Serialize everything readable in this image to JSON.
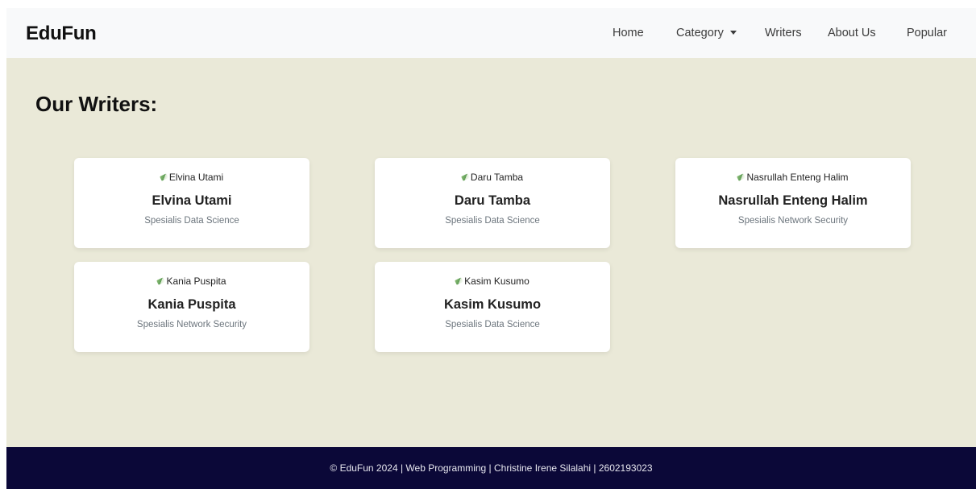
{
  "navbar": {
    "brand": "EduFun",
    "links": {
      "home": "Home",
      "category": "Category",
      "writers": "Writers",
      "about": "About Us",
      "popular": "Popular"
    }
  },
  "main": {
    "title": "Our Writers:",
    "writers": [
      {
        "img_alt": "Elvina Utami",
        "name": "Elvina Utami",
        "specialty": "Spesialis Data Science"
      },
      {
        "img_alt": "Daru Tamba",
        "name": "Daru Tamba",
        "specialty": "Spesialis Data Science"
      },
      {
        "img_alt": "Nasrullah Enteng Halim",
        "name": "Nasrullah Enteng Halim",
        "specialty": "Spesialis Network Security"
      },
      {
        "img_alt": "Kania Puspita",
        "name": "Kania Puspita",
        "specialty": "Spesialis Network Security"
      },
      {
        "img_alt": "Kasim Kusumo",
        "name": "Kasim Kusumo",
        "specialty": "Spesialis Data Science"
      }
    ]
  },
  "footer": {
    "text": "© EduFun 2024 | Web Programming | Christine Irene Silalahi | 2602193023"
  },
  "colors": {
    "navbar_bg": "#f8f9fa",
    "page_bg": "#eae9d8",
    "footer_bg": "#0b0838"
  }
}
